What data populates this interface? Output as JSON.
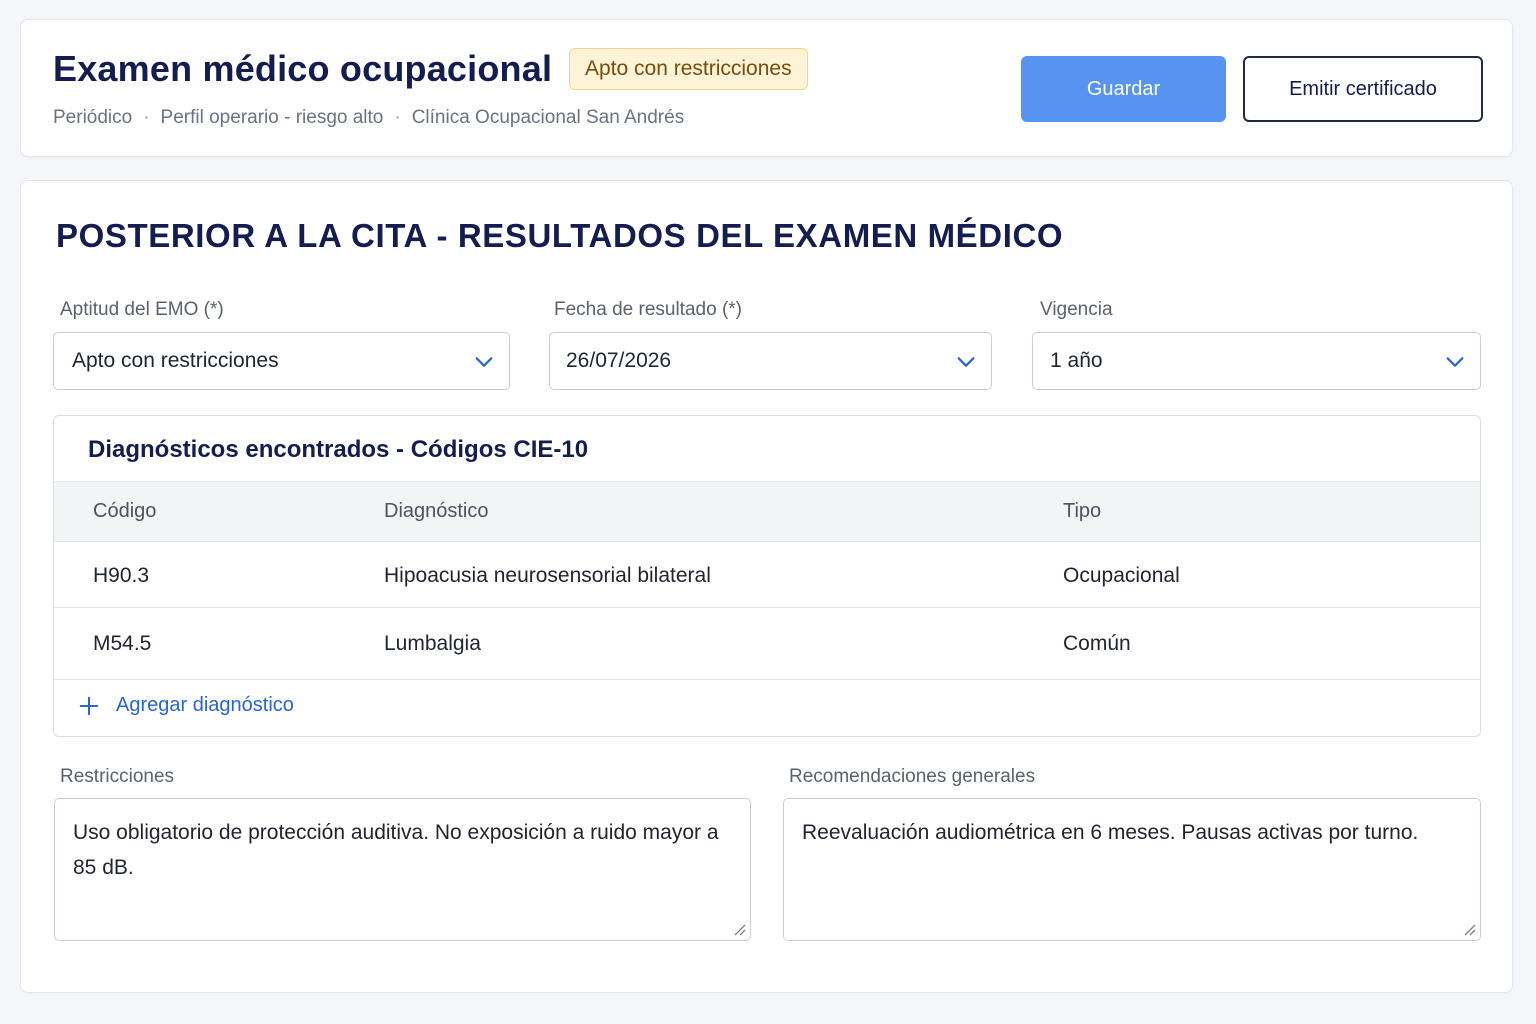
{
  "header": {
    "title": "Examen médico ocupacional",
    "status_badge": "Apto con restricciones",
    "meta": [
      "Periódico",
      "Perfil operario - riesgo alto",
      "Clínica Ocupacional San Andrés"
    ],
    "meta_separator": "·",
    "save_label": "Guardar",
    "certificate_label": "Emitir certificado"
  },
  "section": {
    "title": "POSTERIOR A LA CITA - RESULTADOS DEL EXAMEN MÉDICO"
  },
  "fields": {
    "aptitud": {
      "label": "Aptitud del EMO (*)",
      "value": "Apto con restricciones"
    },
    "fecha": {
      "label": "Fecha de resultado (*)",
      "value": "26/07/2026"
    },
    "vigencia": {
      "label": "Vigencia",
      "value": "1 año"
    }
  },
  "diagnostics": {
    "title": "Diagnósticos encontrados - Códigos CIE-10",
    "columns": [
      "Código",
      "Diagnóstico",
      "Tipo"
    ],
    "rows": [
      {
        "code": "H90.3",
        "diagnosis": "Hipoacusia neurosensorial bilateral",
        "type": "Ocupacional"
      },
      {
        "code": "M54.5",
        "diagnosis": "Lumbalgia",
        "type": "Común"
      }
    ],
    "add_label": "Agregar diagnóstico"
  },
  "restricciones": {
    "label": "Restricciones",
    "value": "Uso obligatorio de protección auditiva. No exposición a ruido mayor a 85 dB."
  },
  "recomendaciones": {
    "label": "Recomendaciones generales",
    "value": "Reevaluación audiométrica en 6 meses. Pausas activas por turno."
  },
  "colors": {
    "primary": "#5794f2",
    "title": "#141d4f",
    "badge_bg": "#fdf3d6",
    "badge_text": "#7a4b0a",
    "link": "#2a63d4"
  },
  "icons": {
    "dropdown": "chevron-down-icon",
    "add": "plus-icon",
    "resize": "resize-grip-icon"
  }
}
